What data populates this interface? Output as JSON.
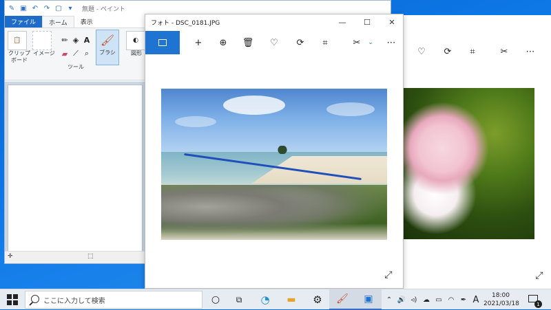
{
  "paint": {
    "title": "無題 - ペイント",
    "tabs": [
      {
        "label": "ファイル"
      },
      {
        "label": "ホーム"
      },
      {
        "label": "表示"
      }
    ],
    "groups": {
      "clipboard": "クリップ ボード",
      "image": "イメージ",
      "tools": "ツール",
      "brush": "ブラシ",
      "shapes": "図形"
    }
  },
  "photos_front": {
    "title": "フォト - DSC_0181.JPG",
    "toolbar_icons": [
      "image-icon",
      "add-icon",
      "zoom-icon",
      "delete-icon",
      "favorite-icon",
      "rotate-icon",
      "crop-icon",
      "edit-icon",
      "more-icon"
    ]
  },
  "taskbar": {
    "search_placeholder": "ここに入力して検索",
    "time": "18:00",
    "date": "2021/03/18",
    "ime": "A",
    "notification_count": "1"
  }
}
